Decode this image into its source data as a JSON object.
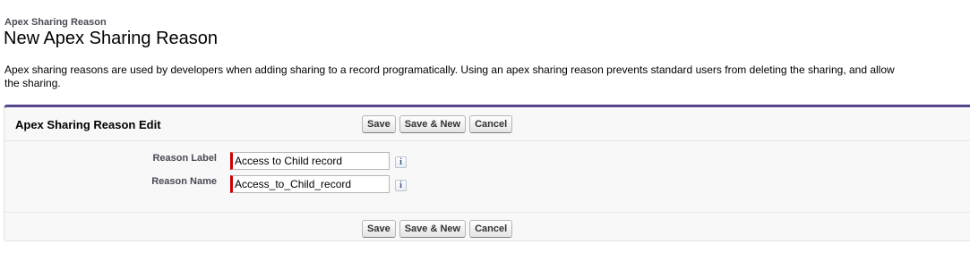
{
  "header": {
    "breadcrumb": "Apex Sharing Reason",
    "title": "New Apex Sharing Reason"
  },
  "description": {
    "line1": "Apex sharing reasons are used by developers when adding sharing to a record programatically. Using an apex sharing reason prevents standard users from deleting the sharing, and allow",
    "line2": "the sharing."
  },
  "panel": {
    "title": "Apex Sharing Reason Edit",
    "buttons": {
      "save": "Save",
      "save_new": "Save & New",
      "cancel": "Cancel"
    },
    "fields": [
      {
        "label": "Reason Label",
        "value": "Access to Child record",
        "required": true
      },
      {
        "label": "Reason Name",
        "value": "Access_to_Child_record",
        "required": true
      }
    ],
    "info_icon_glyph": "i"
  },
  "colors": {
    "panel_accent": "#56458c",
    "required_marker": "#cc0000"
  },
  "icons": {
    "help": "info-icon"
  }
}
